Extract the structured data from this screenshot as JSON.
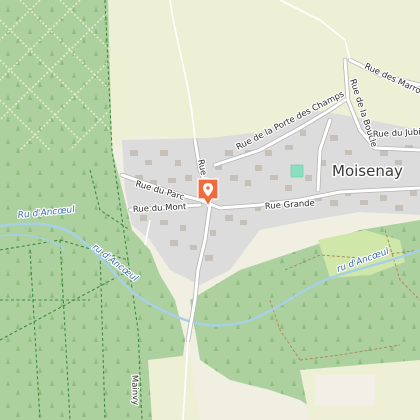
{
  "map": {
    "town_label": "Moisenay",
    "road_labels": {
      "rue_du_parc": "Rue du Parc",
      "rue_du_mont": "Rue du Mont",
      "rue_grande": "Rue Grande",
      "rue_porte_des_champs": "Rue de la Porte des Champs",
      "rue_de_la_boucle": "Rue de la Boucle",
      "rue_des_marronniers": "Rue des Marronni",
      "rue_du_jubile": "Rue du Jubil",
      "rue_de_seine": "Rue de S",
      "route_south": "Mainvy"
    },
    "water_labels": {
      "ru_ancoeul_west": "Ru d'Ancœul",
      "ru_ancoeul_mid": "ru d'Ancœul",
      "ru_ancoeul_east": "ru d'Ancœul"
    },
    "marker": {
      "icon": "location-pin-icon",
      "color": "#f26b3a"
    },
    "colors": {
      "forest": "#add19e",
      "field": "#eef0d5",
      "meadow": "#cfe7a8",
      "town": "#dddddd",
      "building": "#c9c2bb",
      "water": "#a8cfe8",
      "road": "#ffffff",
      "sports_pitch": "#88e0be"
    }
  }
}
